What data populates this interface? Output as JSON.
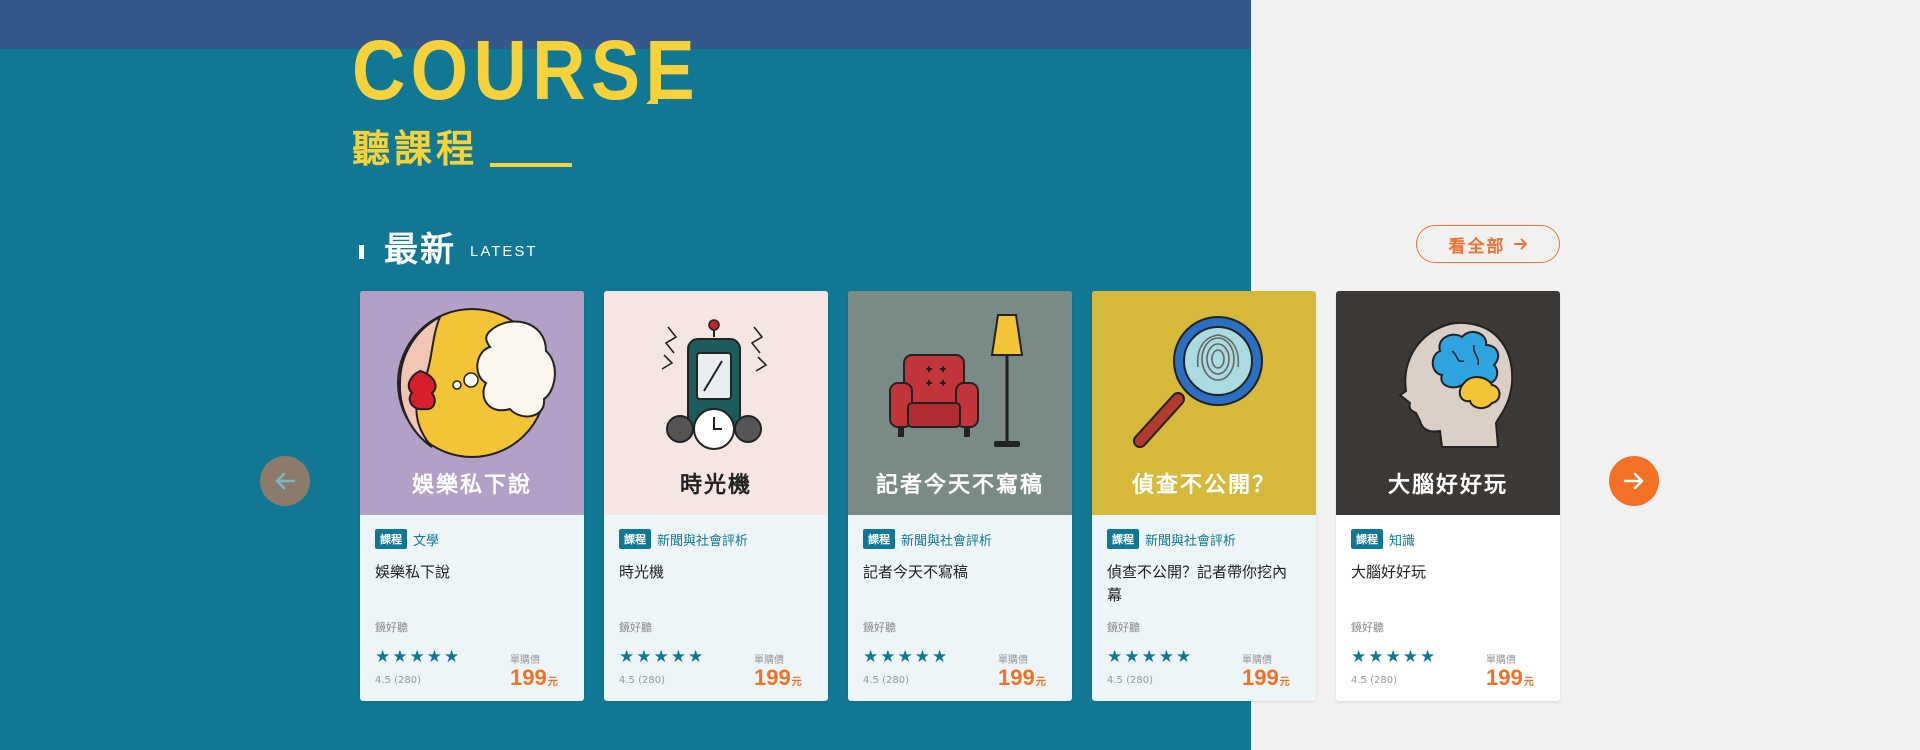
{
  "hero": {
    "title": "COURSE",
    "subtitle": "聽課程"
  },
  "section": {
    "title": "最新",
    "subtitle_en": "LATEST",
    "see_all_label": "看全部",
    "see_all_icon": "arrow-right-icon"
  },
  "nav": {
    "prev_icon": "arrow-left-icon",
    "next_icon": "arrow-right-icon"
  },
  "colors": {
    "teal": "#107894",
    "topbar": "#35588c",
    "yellow": "#f7d23a",
    "orange": "#f37024"
  },
  "cards": [
    {
      "image_title": "娛樂私下說",
      "image_bg": "#b2a0c7",
      "image_title_color": "#ffffff",
      "icon": "gossip-lips-icon",
      "tag": "課程",
      "category": "文學",
      "title": "娛樂私下說",
      "publisher": "鏡好聽",
      "rating": "4.5 (280)",
      "price_label": "單購價",
      "price": "199",
      "currency": "元"
    },
    {
      "image_title": "時光機",
      "image_bg": "#f6e6e3",
      "image_title_color": "#222222",
      "icon": "time-machine-icon",
      "tag": "課程",
      "category": "新聞與社會評析",
      "title": "時光機",
      "publisher": "鏡好聽",
      "rating": "4.5 (280)",
      "price_label": "單購價",
      "price": "199",
      "currency": "元"
    },
    {
      "image_title": "記者今天不寫稿",
      "image_bg": "#7a8a86",
      "image_title_color": "#ffffff",
      "icon": "armchair-lamp-icon",
      "tag": "課程",
      "category": "新聞與社會評析",
      "title": "記者今天不寫稿",
      "publisher": "鏡好聽",
      "rating": "4.5 (280)",
      "price_label": "單購價",
      "price": "199",
      "currency": "元"
    },
    {
      "image_title": "偵查不公開？",
      "image_bg": "#d6b83a",
      "image_title_color": "#ffffff",
      "icon": "magnifier-fingerprint-icon",
      "tag": "課程",
      "category": "新聞與社會評析",
      "title": "偵查不公開？記者帶你挖內幕",
      "publisher": "鏡好聽",
      "rating": "4.5 (280)",
      "price_label": "單購價",
      "price": "199",
      "currency": "元"
    },
    {
      "image_title": "大腦好好玩",
      "image_bg": "#3b3836",
      "image_title_color": "#ffffff",
      "icon": "brain-head-icon",
      "tag": "課程",
      "category": "知識",
      "title": "大腦好好玩",
      "publisher": "鏡好聽",
      "rating": "4.5 (280)",
      "price_label": "單購價",
      "price": "199",
      "currency": "元"
    }
  ]
}
